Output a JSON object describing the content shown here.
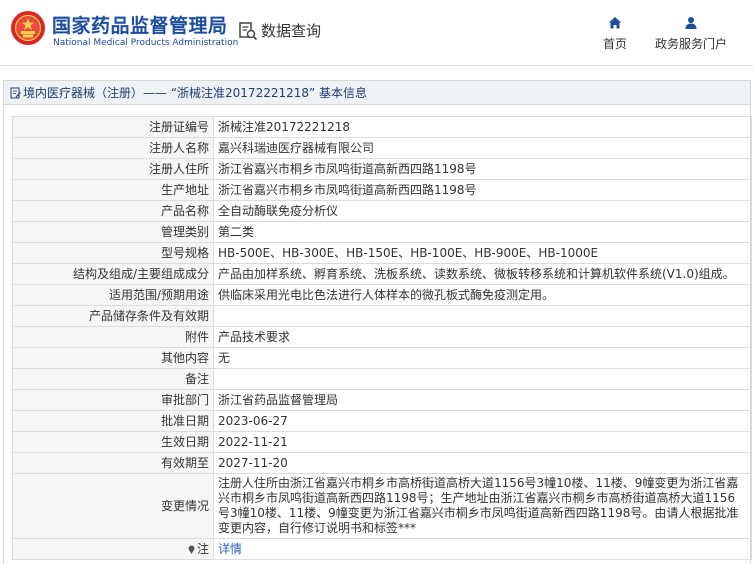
{
  "header": {
    "brand_cn": "国家药品监督管理局",
    "brand_en": "National Medical Products Administration",
    "query_label": "数据查询",
    "nav": [
      {
        "label": "首页",
        "icon": "home-icon"
      },
      {
        "label": "政务服务门户",
        "icon": "user-icon"
      }
    ]
  },
  "breadcrumb": "境内医疗器械（注册）—— “浙械注准20172221218” 基本信息",
  "rows": [
    {
      "label": "注册证编号",
      "value": "浙械注准20172221218"
    },
    {
      "label": "注册人名称",
      "value": "嘉兴科瑞迪医疗器械有限公司"
    },
    {
      "label": "注册人住所",
      "value": "浙江省嘉兴市桐乡市凤鸣街道高新西四路1198号"
    },
    {
      "label": "生产地址",
      "value": "浙江省嘉兴市桐乡市凤鸣街道高新西四路1198号"
    },
    {
      "label": "产品名称",
      "value": "全自动酶联免疫分析仪"
    },
    {
      "label": "管理类别",
      "value": "第二类"
    },
    {
      "label": "型号规格",
      "value": "HB-500E、HB-300E、HB-150E、HB-100E、HB-900E、HB-1000E"
    },
    {
      "label": "结构及组成/主要组成成分",
      "value": "产品由加样系统、孵育系统、洗板系统、读数系统、微板转移系统和计算机软件系统(V1.0)组成。"
    },
    {
      "label": "适用范围/预期用途",
      "value": "供临床采用光电比色法进行人体样本的微孔板式酶免疫测定用。"
    },
    {
      "label": "产品储存条件及有效期",
      "value": ""
    },
    {
      "label": "附件",
      "value": "产品技术要求"
    },
    {
      "label": "其他内容",
      "value": "无"
    },
    {
      "label": "备注",
      "value": ""
    },
    {
      "label": "审批部门",
      "value": "浙江省药品监督管理局"
    },
    {
      "label": "批准日期",
      "value": "2023-06-27"
    },
    {
      "label": "生效日期",
      "value": "2022-11-21"
    },
    {
      "label": "有效期至",
      "value": "2027-11-20"
    },
    {
      "label": "变更情况",
      "value": "注册人住所由浙江省嘉兴市桐乡市高桥街道高桥大道1156号3幢10楼、11楼、9幢变更为浙江省嘉兴市桐乡市凤鸣街道高新西四路1198号；生产地址由浙江省嘉兴市桐乡市高桥街道高桥大道1156号3幢10楼、11楼、9幢变更为浙江省嘉兴市桐乡市凤鸣街道高新西四路1198号。由请人根据批准变更内容，自行修订说明书和标签***"
    },
    {
      "label": "注",
      "value": "详情"
    }
  ],
  "colors": {
    "brand": "#1b4da0",
    "link": "#2a64c6",
    "label_bg": "#f5f6f8"
  }
}
